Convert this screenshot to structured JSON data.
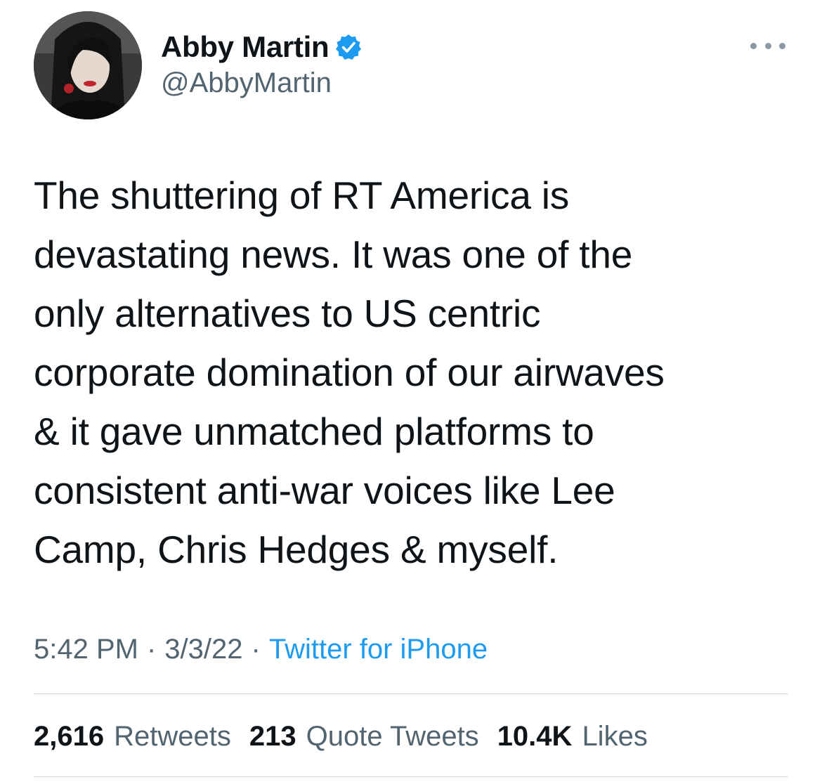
{
  "author": {
    "display_name": "Abby Martin",
    "handle": "@AbbyMartin",
    "verified": true,
    "avatar_icon": "profile-photo"
  },
  "tweet": {
    "text": "The shuttering of RT America is\ndevastating news. It was one of the\nonly alternatives to US centric\ncorporate domination of our airwaves\n& it gave unmatched platforms to\nconsistent anti-war voices like Lee\nCamp, Chris Hedges & myself."
  },
  "meta": {
    "time": "5:42 PM",
    "separator": "·",
    "date": "3/3/22",
    "source": "Twitter for iPhone"
  },
  "stats": {
    "retweets_count": "2,616",
    "retweets_label": "Retweets",
    "quotes_count": "213",
    "quotes_label": "Quote Tweets",
    "likes_count": "10.4K",
    "likes_label": "Likes"
  },
  "colors": {
    "text_primary": "#0f1419",
    "text_secondary": "#536471",
    "accent": "#1d9bf0",
    "divider": "#cfd9de"
  }
}
